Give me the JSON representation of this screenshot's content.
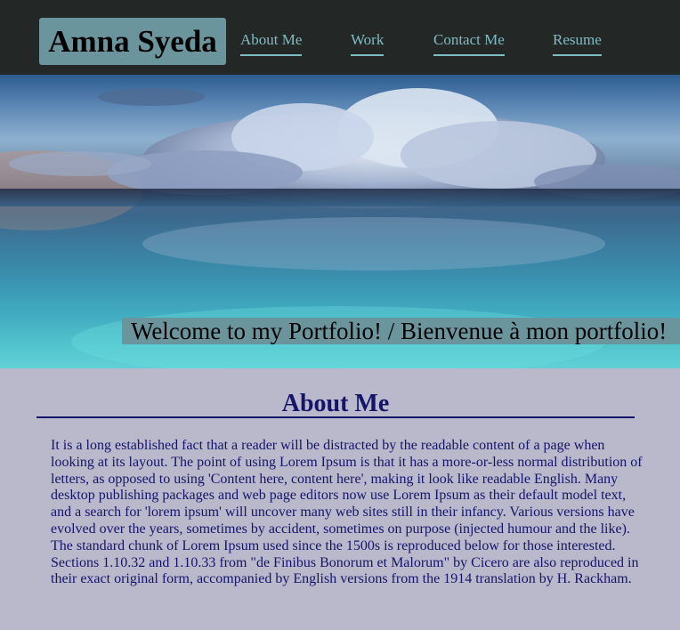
{
  "header": {
    "name": "Amna Syeda",
    "nav": [
      {
        "label": "About Me"
      },
      {
        "label": "Work"
      },
      {
        "label": "Contact Me"
      },
      {
        "label": "Resume"
      }
    ]
  },
  "hero": {
    "welcome": "Welcome to my Portfolio! / Bienvenue à mon portfolio!"
  },
  "about": {
    "title": "About Me",
    "body": "It is a long established fact that a reader will be distracted by the readable content of a page when looking at its layout. The point of using Lorem Ipsum is that it has a more-or-less normal distribution of letters, as opposed to using 'Content here, content here', making it look like readable English. Many desktop publishing packages and web page editors now use Lorem Ipsum as their default model text, and a search for 'lorem ipsum' will uncover many web sites still in their infancy. Various versions have evolved over the years, sometimes by accident, sometimes on purpose (injected humour and the like). The standard chunk of Lorem Ipsum used since the 1500s is reproduced below for those interested. Sections 1.10.32 and 1.10.33 from \"de Finibus Bonorum et Malorum\" by Cicero are also reproduced in their exact original form, accompanied by English versions from the 1914 translation by H. Rackham."
  },
  "colors": {
    "header_bg": "#232726",
    "accent": "#6b959c",
    "nav_text": "#7fbcc4",
    "page_bg": "#b9b9cb",
    "text": "#14146b"
  }
}
